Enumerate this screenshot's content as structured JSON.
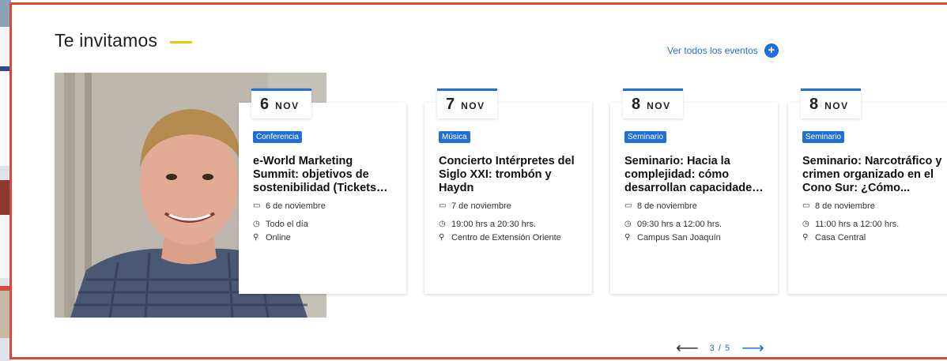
{
  "section": {
    "title": "Te invitamos",
    "see_all_label": "Ver todos los eventos",
    "accent_color": "#f2c300",
    "link_color": "#1f6fd4"
  },
  "events": [
    {
      "day": "6",
      "month": "NOV",
      "tag": "Conferencia",
      "title": "e-World Marketing Summit: objetivos de sostenibilidad (Tickets…",
      "date": "6 de noviembre",
      "time": "Todo el día",
      "place": "Online"
    },
    {
      "day": "7",
      "month": "NOV",
      "tag": "Música",
      "title": "Concierto Intérpretes del Siglo XXI: trombón y Haydn",
      "date": "7 de noviembre",
      "time": "19:00 hrs a 20:30 hrs.",
      "place": "Centro de Extensión Oriente"
    },
    {
      "day": "8",
      "month": "NOV",
      "tag": "Seminario",
      "title": "Seminario: Hacia la complejidad: cómo desarrollan capacidade…",
      "date": "8 de noviembre",
      "time": "09:30 hrs a 12:00 hrs.",
      "place": "Campus San Joaquín"
    },
    {
      "day": "8",
      "month": "NOV",
      "tag": "Seminario",
      "title": "Seminario: Narcotráfico y crimen organizado en el Cono Sur: ¿Cómo...",
      "date": "8 de noviembre",
      "time": "11:00 hrs a 12:00 hrs.",
      "place": "Casa Central"
    }
  ],
  "pager": {
    "text": "3 / 5",
    "prev_icon": "arrow-left-icon",
    "next_icon": "arrow-right-icon"
  },
  "icons": {
    "calendar": "calendar-icon",
    "clock": "clock-icon",
    "location": "location-pin-icon",
    "plus": "plus-circle-icon"
  }
}
